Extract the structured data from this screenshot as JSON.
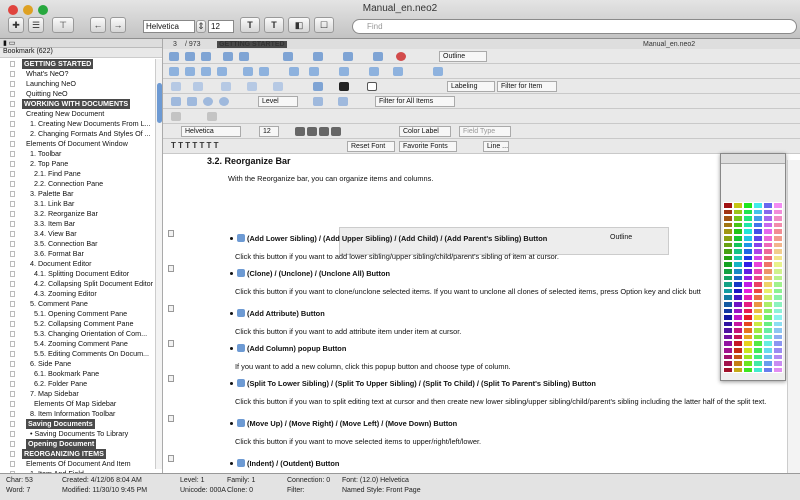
{
  "window": {
    "title": "Manual_en.neo2"
  },
  "toolbar": {
    "font": "Helvetica",
    "size": "12",
    "search_placeholder": "Find"
  },
  "sidebar": {
    "header": "Bookmark (622)",
    "items": [
      {
        "label": "GETTING STARTED",
        "indent": 0,
        "sel": true
      },
      {
        "label": "What's NeO?",
        "indent": 1
      },
      {
        "label": "Launching NeO",
        "indent": 1
      },
      {
        "label": "Quitting NeO",
        "indent": 1
      },
      {
        "label": "WORKING WITH DOCUMENTS",
        "indent": 0,
        "sel": true
      },
      {
        "label": "Creating New Document",
        "indent": 1
      },
      {
        "label": "1. Creating New Documents From L...",
        "indent": 2
      },
      {
        "label": "2. Changing Formats And Styles Of ...",
        "indent": 2
      },
      {
        "label": "Elements Of Document Window",
        "indent": 1
      },
      {
        "label": "1. Toolbar",
        "indent": 2
      },
      {
        "label": "2. Top Pane",
        "indent": 2
      },
      {
        "label": "2.1. Find Pane",
        "indent": 3
      },
      {
        "label": "2.2. Connection Pane",
        "indent": 3
      },
      {
        "label": "3. Palette Bar",
        "indent": 2
      },
      {
        "label": "3.1. Link Bar",
        "indent": 3
      },
      {
        "label": "3.2. Reorganize Bar",
        "indent": 3
      },
      {
        "label": "3.3. Item Bar",
        "indent": 3
      },
      {
        "label": "3.4. View Bar",
        "indent": 3
      },
      {
        "label": "3.5. Connection Bar",
        "indent": 3
      },
      {
        "label": "3.6. Format Bar",
        "indent": 3
      },
      {
        "label": "4. Document Editor",
        "indent": 2
      },
      {
        "label": "4.1. Splitting Document Editor",
        "indent": 3
      },
      {
        "label": "4.2. Collapsing Split Document Editor",
        "indent": 3
      },
      {
        "label": "4.3. Zooming Editor",
        "indent": 3
      },
      {
        "label": "5. Comment Pane",
        "indent": 2
      },
      {
        "label": "5.1. Opening Comment Pane",
        "indent": 3
      },
      {
        "label": "5.2. Collapsing Comment Pane",
        "indent": 3
      },
      {
        "label": "5.3. Changing Orientation of Com...",
        "indent": 3
      },
      {
        "label": "5.4. Zooming Comment Pane",
        "indent": 3
      },
      {
        "label": "5.5. Editing Comments On Docum...",
        "indent": 3
      },
      {
        "label": "6. Side Pane",
        "indent": 2
      },
      {
        "label": "6.1. Bookmark Pane",
        "indent": 3
      },
      {
        "label": "6.2. Folder Pane",
        "indent": 3
      },
      {
        "label": "7. Map Sidebar",
        "indent": 2
      },
      {
        "label": "Elements Of Map Sidebar",
        "indent": 3
      },
      {
        "label": "8. Item Information Toolbar",
        "indent": 2
      },
      {
        "label": "Saving Documents",
        "indent": 1,
        "sel": true
      },
      {
        "label": "• Saving Documents To Library",
        "indent": 2
      },
      {
        "label": "Opening Document",
        "indent": 1,
        "sel": true
      },
      {
        "label": "REORGANIZING ITEMS",
        "indent": 0,
        "sel": true
      },
      {
        "label": "Elements Of Document And Item",
        "indent": 1
      },
      {
        "label": "1. Item And Field",
        "indent": 2
      }
    ]
  },
  "nav": {
    "page": "3",
    "total": "/ 973",
    "current": "GETTING STARTED",
    "doc": "Manual_en.neo2"
  },
  "bars": {
    "outline": "Outline",
    "labeling": "Labeling",
    "filter_item": "Filter for Item",
    "level": "Level",
    "filter_all": "Filter for All Items",
    "format_font": "Helvetica",
    "format_size": "12",
    "color_label": "Color Label",
    "field_type": "Field Type",
    "reset_font": "Reset Font",
    "favorite_fonts": "Favorite Fonts",
    "line": "Line ..."
  },
  "doc": {
    "heading": "3.2.  Reorganize Bar",
    "intro": "With the Reorganize bar, you can organize items and columns.",
    "inline_outline": "Outline",
    "bullets": [
      {
        "title": "(Add Lower Sibling) /  (Add Upper Sibling) /  (Add Child) /  (Add Parent's Sibling) Button",
        "text": "Click this button if you want to add lower sibling/upper sibling/child/parent's sibling of item at cursor."
      },
      {
        "title": "(Clone) /  (Unclone) /  (Unclone All) Button",
        "text": "Click this button if you want to clone/unclone selected items. If you want to unclone all clones of selected items, press Option key and click      butt"
      },
      {
        "title": "(Add Attribute) Button",
        "text": "Click this button if you want to add attribute item under item at cursor."
      },
      {
        "title": "(Add Column) popup Button",
        "text": "If you want to add a new column, click this popup button and choose type of column."
      },
      {
        "title": "(Split To Lower Sibling) /  (Split To Upper Sibling) /  (Split To Child) /  (Split To Parent's Sibling) Button",
        "text": "Click this button if you wan to split editing text at cursor and then create new lower sibling/upper sibling/child/parent's sibling including the latter half of the split text."
      },
      {
        "title": "(Move Up) /  (Move Right) /  (Move Left) /  (Move Down) Button",
        "text": "Click this button if you want to move selected items to upper/right/left/lower."
      },
      {
        "title": "(Indent) /  (Outdent) Button",
        "text": ""
      }
    ]
  },
  "status": {
    "char": "Char: 53",
    "word": "Word: 7",
    "created": "Created:   4/12/06 8:04 AM",
    "modified": "Modified:  11/30/10 9:45 PM",
    "level": "Level:      1",
    "unicode": "Unicode: 000A",
    "family": "Family:   1",
    "clone": "Clone:   0",
    "connection": "Connection:   0",
    "filter": "Filter:",
    "font": "Font:  (12.0) Helvetica",
    "style": "Named Style:  Front Page"
  },
  "colors": {
    "accent": "#6d9ad3",
    "selected_bg": "#4a4a4a"
  }
}
